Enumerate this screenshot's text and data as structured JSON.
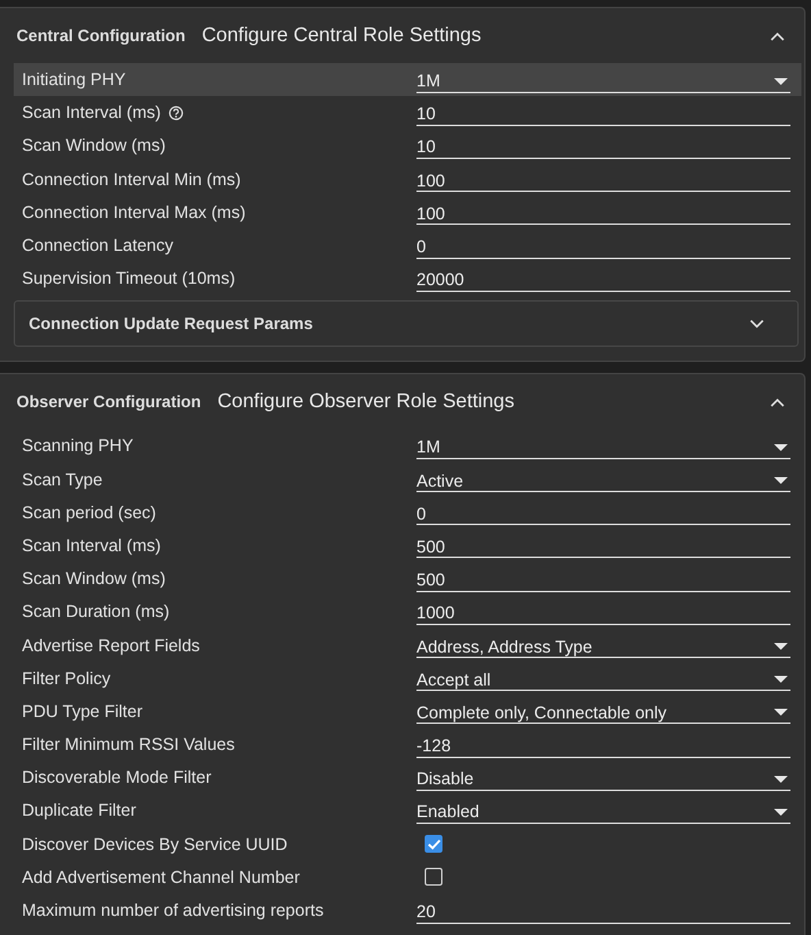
{
  "panels": [
    {
      "title": "Central Configuration",
      "subtitle": "Configure Central Role Settings",
      "expanded": true,
      "rows": [
        {
          "label": "Initiating PHY",
          "kind": "select",
          "value": "1M",
          "highlighted": true,
          "help": false
        },
        {
          "label": "Scan Interval (ms)",
          "kind": "text",
          "value": "10",
          "highlighted": false,
          "help": true
        },
        {
          "label": "Scan Window (ms)",
          "kind": "text",
          "value": "10",
          "highlighted": false,
          "help": false
        },
        {
          "label": "Connection Interval Min (ms)",
          "kind": "text",
          "value": "100",
          "highlighted": false,
          "help": false
        },
        {
          "label": "Connection Interval Max (ms)",
          "kind": "text",
          "value": "100",
          "highlighted": false,
          "help": false
        },
        {
          "label": "Connection Latency",
          "kind": "text",
          "value": "0",
          "highlighted": false,
          "help": false
        },
        {
          "label": "Supervision Timeout (10ms)",
          "kind": "text",
          "value": "20000",
          "highlighted": false,
          "help": false
        }
      ],
      "subpanels": [
        {
          "title": "Connection Update Request Params",
          "expanded": false
        }
      ]
    },
    {
      "title": "Observer Configuration",
      "subtitle": "Configure Observer Role Settings",
      "expanded": true,
      "rows": [
        {
          "label": "Scanning PHY",
          "kind": "select",
          "value": "1M",
          "highlighted": false,
          "help": false
        },
        {
          "label": "Scan Type",
          "kind": "select",
          "value": "Active",
          "highlighted": false,
          "help": false
        },
        {
          "label": "Scan period (sec)",
          "kind": "text",
          "value": "0",
          "highlighted": false,
          "help": false
        },
        {
          "label": "Scan Interval (ms)",
          "kind": "text",
          "value": "500",
          "highlighted": false,
          "help": false
        },
        {
          "label": "Scan Window (ms)",
          "kind": "text",
          "value": "500",
          "highlighted": false,
          "help": false
        },
        {
          "label": "Scan Duration (ms)",
          "kind": "text",
          "value": "1000",
          "highlighted": false,
          "help": false
        },
        {
          "label": "Advertise Report Fields",
          "kind": "select",
          "value": "Address, Address Type",
          "highlighted": false,
          "help": false
        },
        {
          "label": "Filter Policy",
          "kind": "select",
          "value": "Accept all",
          "highlighted": false,
          "help": false
        },
        {
          "label": "PDU Type Filter",
          "kind": "select",
          "value": "Complete only, Connectable only",
          "highlighted": false,
          "help": false
        },
        {
          "label": "Filter Minimum RSSI Values",
          "kind": "text",
          "value": "-128",
          "highlighted": false,
          "help": false
        },
        {
          "label": "Discoverable Mode Filter",
          "kind": "select",
          "value": "Disable",
          "highlighted": false,
          "help": false
        },
        {
          "label": "Duplicate Filter",
          "kind": "select",
          "value": "Enabled",
          "highlighted": false,
          "help": false
        },
        {
          "label": "Discover Devices By Service UUID",
          "kind": "checkbox",
          "checked": true,
          "highlighted": false,
          "help": false
        },
        {
          "label": "Add Advertisement Channel Number",
          "kind": "checkbox",
          "checked": false,
          "highlighted": false,
          "help": false
        },
        {
          "label": "Maximum number of advertising reports",
          "kind": "text",
          "value": "20",
          "highlighted": false,
          "help": false
        }
      ]
    }
  ]
}
